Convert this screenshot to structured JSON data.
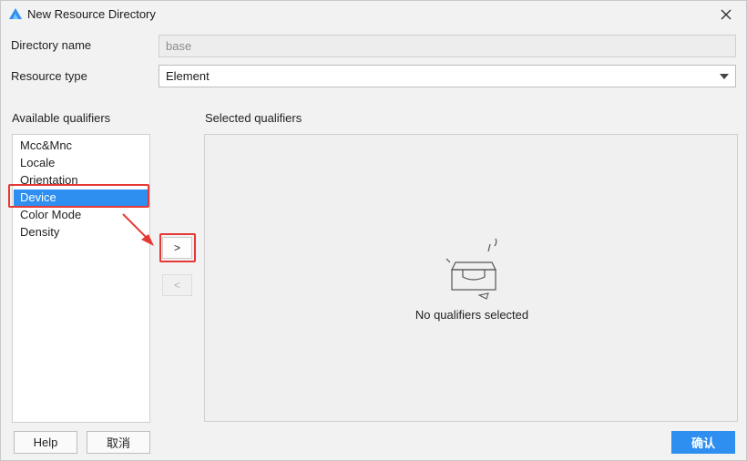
{
  "window": {
    "title": "New Resource Directory",
    "icon": "harmony-app-icon",
    "close_icon": "close-icon"
  },
  "form": {
    "directory_name_label": "Directory name",
    "directory_name_value": "base",
    "resource_type_label": "Resource type",
    "resource_type_value": "Element"
  },
  "available": {
    "label": "Available qualifiers",
    "items": [
      "Mcc&Mnc",
      "Locale",
      "Orientation",
      "Device",
      "Color Mode",
      "Density"
    ],
    "selected_item": "Device"
  },
  "selected": {
    "label": "Selected qualifiers",
    "empty_text": "No qualifiers selected"
  },
  "buttons": {
    "add": ">",
    "remove": "<",
    "help": "Help",
    "cancel": "取消",
    "confirm": "确认"
  },
  "colors": {
    "accent": "#2e8ff0",
    "annotation": "#e53935"
  }
}
